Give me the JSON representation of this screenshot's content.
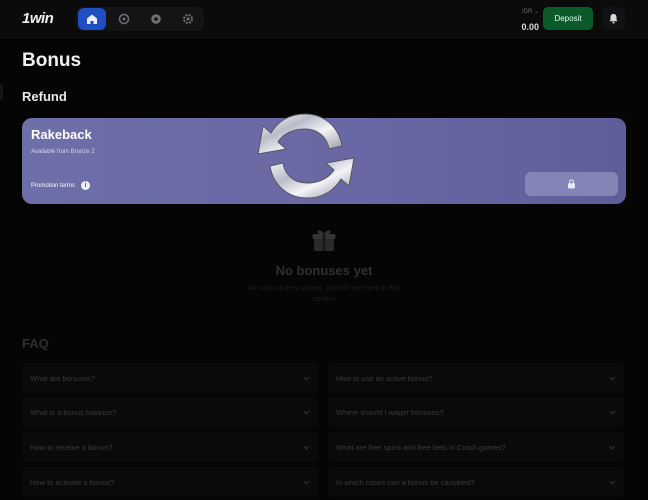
{
  "header": {
    "logo": "1win",
    "nav": [
      {
        "name": "home",
        "icon": "home-icon",
        "active": true
      },
      {
        "name": "casino",
        "icon": "chip-icon",
        "active": false
      },
      {
        "name": "sports",
        "icon": "ball-icon",
        "active": false
      },
      {
        "name": "settings",
        "icon": "gear-icon",
        "active": false
      }
    ],
    "currency": "IDR ⌄",
    "balance": "0.00",
    "deposit_label": "Deposit"
  },
  "page": {
    "title": "Bonus",
    "section_title": "Refund"
  },
  "card": {
    "title": "Rakeback",
    "subtitle": "Available from Bronze 2",
    "promo_label": "Promotion terms",
    "promo_info": "i",
    "gradient_color": "#6e6ea8"
  },
  "empty": {
    "title": "No bonuses yet",
    "text": "As soon as they appear, you will see them in this section"
  },
  "faq": {
    "title": "FAQ",
    "items": [
      {
        "q": "What are bonuses?"
      },
      {
        "q": "How to use an active bonus?"
      },
      {
        "q": "What is a bonus balance?"
      },
      {
        "q": "Where should I wager bonuses?"
      },
      {
        "q": "How to receive a bonus?"
      },
      {
        "q": "What are free spins and free bets in Crash games?"
      },
      {
        "q": "How to activate a bonus?"
      },
      {
        "q": "In which cases can a bonus be canceled?"
      }
    ]
  },
  "colors": {
    "background": "#050505",
    "accent_blue": "#1e4ec2",
    "deposit_green": "#0b5a2c",
    "card": "#6e6ea8"
  }
}
